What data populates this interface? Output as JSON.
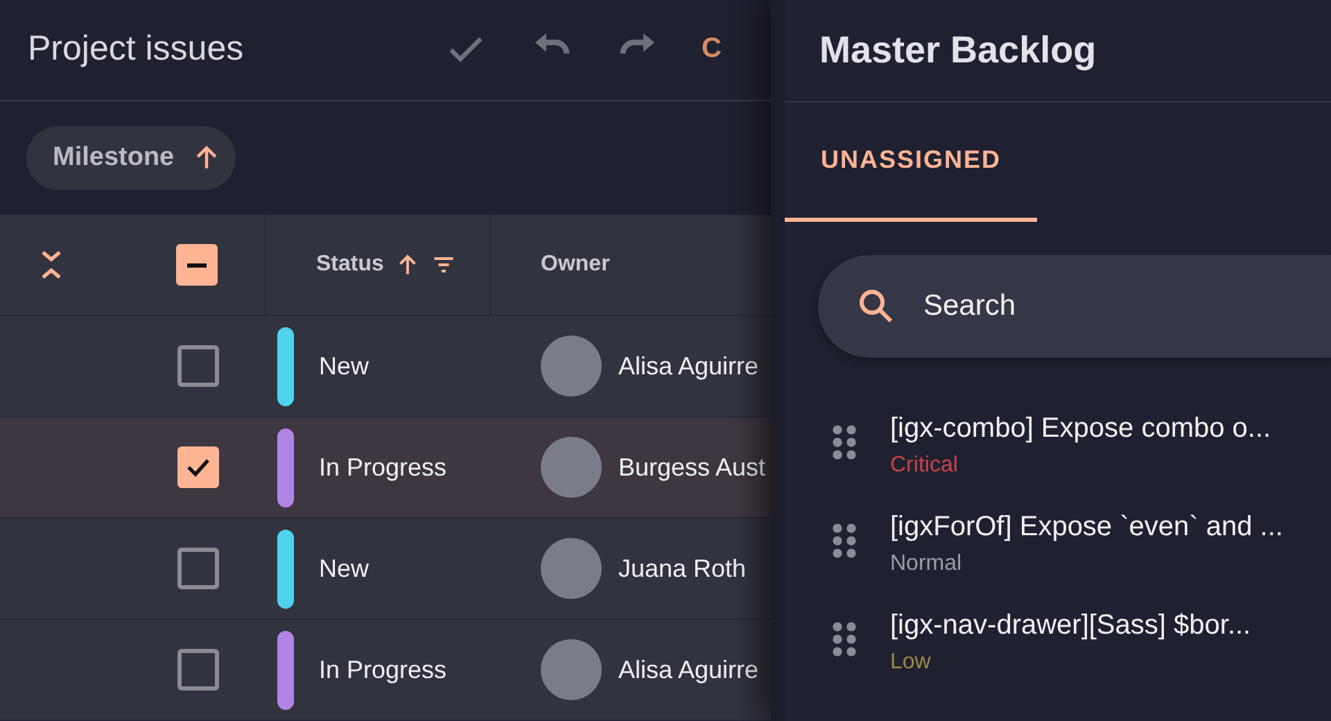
{
  "grid": {
    "title": "Project issues",
    "toolbar": [
      {
        "kind": "check"
      },
      {
        "kind": "undo"
      },
      {
        "kind": "redo"
      },
      {
        "kind": "text",
        "label": "C"
      }
    ],
    "group_chips": [
      {
        "label": "Milestone",
        "ascending": true
      }
    ],
    "header_checkbox": {
      "indeterminate": true
    },
    "columns": [
      {
        "label": "Status",
        "sorted": true,
        "filterable": true
      },
      {
        "label": "Owner",
        "sorted": false,
        "filterable": false
      }
    ],
    "rows": [
      {
        "checked": false,
        "selected": false,
        "status": "New",
        "color": "#4fd2ee",
        "owner": "Alisa Aguirre"
      },
      {
        "checked": true,
        "selected": true,
        "status": "In Progress",
        "color": "#b185e6",
        "owner": "Burgess Aust"
      },
      {
        "checked": false,
        "selected": false,
        "status": "New",
        "color": "#4fd2ee",
        "owner": "Juana Roth"
      },
      {
        "checked": false,
        "selected": false,
        "status": "In Progress",
        "color": "#b185e6",
        "owner": "Alisa Aguirre"
      }
    ]
  },
  "drawer": {
    "title": "Master Backlog",
    "tabs": [
      {
        "label": "UNASSIGNED",
        "selected": true
      }
    ],
    "search": {
      "placeholder": "Search"
    },
    "items": [
      {
        "title": "[igx-combo] Expose combo o...",
        "priority": "Critical",
        "color": "#c9424a"
      },
      {
        "title": "[igxForOf] Expose `even` and ...",
        "priority": "Normal",
        "color": "#9a9ca6"
      },
      {
        "title": "[igx-nav-drawer][Sass] $bor...",
        "priority": "Low",
        "color": "#9c8745"
      }
    ]
  }
}
